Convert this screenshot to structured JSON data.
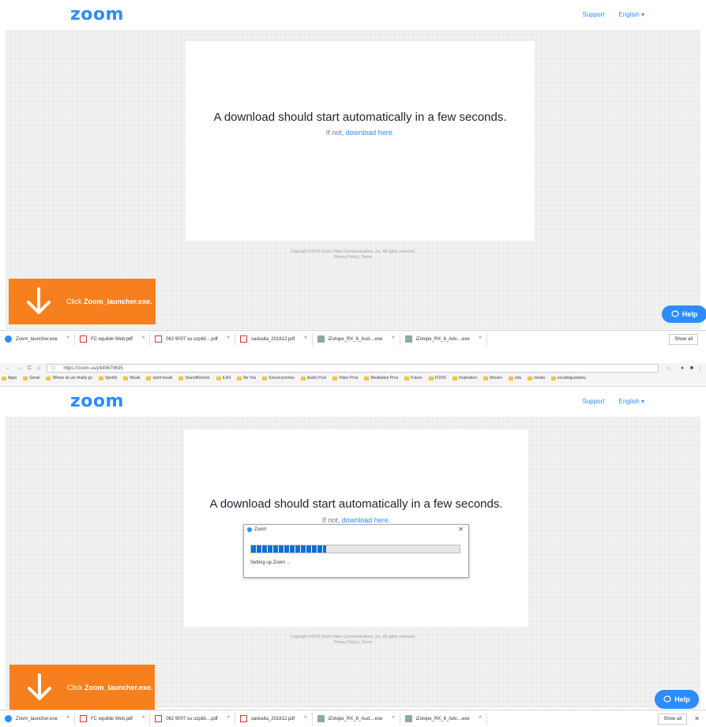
{
  "zoom_page": {
    "logo": "zoom",
    "support": "Support",
    "language": "English ▾",
    "message": "A download should start automatically in a few seconds.",
    "if_not": "If not,",
    "download_link": "download here.",
    "copyright": "Copyright ©2018 Zoom Video Communications, Inc. All rights reserved.",
    "privacy": "Privacy Policy | Terms",
    "banner_prefix": "Click",
    "banner_file": "Zoom_launcher.exe.",
    "help": "Help"
  },
  "browser": {
    "url": "https://zoom.us/j/449679635",
    "bookmarks": [
      "Apps",
      "Gmail",
      "Where do we finally go",
      "Spotify",
      "Musik",
      "spirit musik",
      "SoundKitchen",
      "ILAS",
      "Be You",
      "Sound promos",
      "Audio Post",
      "Video Pros",
      "Meditation Pros",
      "Future",
      "FOOD",
      "Inspiration",
      "Movies",
      "edu",
      "media",
      "vocalingustatory"
    ]
  },
  "downloads": {
    "items": [
      {
        "name": "Zoom_launcher.exe",
        "icon": "zoom-icon"
      },
      {
        "name": "FC equilde Web.pdf",
        "icon": "pdf-icon"
      },
      {
        "name": "062 9007 su uzpild....pdf",
        "icon": "pdf-icon"
      },
      {
        "name": "saskaita_201812.pdf",
        "icon": "pdf-icon"
      },
      {
        "name": "iZotope_RX_6_Aud....exe",
        "icon": "installer-icon"
      },
      {
        "name": "iZotope_RX_6_Adv....exe",
        "icon": "installer-icon"
      }
    ],
    "show_all": "Show all"
  },
  "dialog": {
    "title": "Zoom",
    "status": "Setting up Zoom ...",
    "progress": 0.36
  },
  "colors": {
    "zoom_blue": "#2d8cff",
    "banner_orange": "#f7801e"
  }
}
